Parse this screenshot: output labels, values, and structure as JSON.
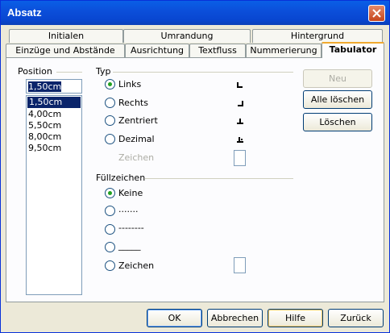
{
  "window": {
    "title": "Absatz"
  },
  "tabs_row1": [
    "Initialen",
    "Umrandung",
    "Hintergrund"
  ],
  "tabs_row2": [
    "Einzüge und Abstände",
    "Ausrichtung",
    "Textfluss",
    "Nummerierung",
    "Tabulator"
  ],
  "position": {
    "label": "Position",
    "input_value": "1,50cm",
    "items": [
      "1,50cm",
      "4,00cm",
      "5,50cm",
      "8,00cm",
      "9,50cm"
    ]
  },
  "typ": {
    "label": "Typ",
    "options": [
      "Links",
      "Rechts",
      "Zentriert",
      "Dezimal"
    ],
    "selected": "Links",
    "zeichen_label": "Zeichen"
  },
  "fill": {
    "label": "Füllzeichen",
    "options": [
      "Keine",
      ".......",
      "--------",
      "_____",
      "Zeichen"
    ],
    "selected": "Keine"
  },
  "side_buttons": {
    "neu": "Neu",
    "alle_loeschen": "Alle löschen",
    "loeschen": "Löschen"
  },
  "footer": {
    "ok": "OK",
    "abbrechen": "Abbrechen",
    "hilfe": "Hilfe",
    "zurueck": "Zurück"
  }
}
